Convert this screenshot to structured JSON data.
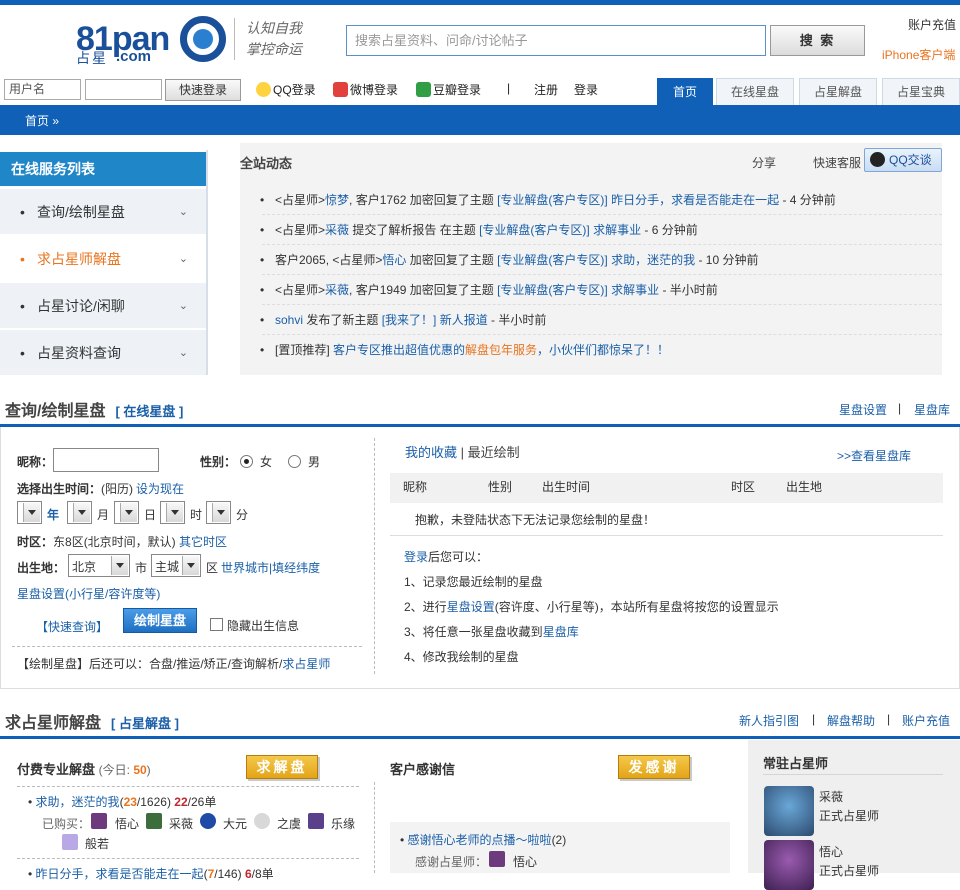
{
  "header": {
    "logo_num": "81pan",
    "logo_zx": "占星",
    "logo_com": ".com",
    "slogan_1": "认知自我",
    "slogan_2": "掌控命运",
    "search_placeholder": "搜索占星资料、问命/讨论帖子",
    "search_label": "搜 索",
    "recharge": "账户充值",
    "iphone": "iPhone客户端"
  },
  "login": {
    "username_placeholder": "用户名",
    "password_placeholder": "",
    "quick_login": "快速登录",
    "qq": "QQ登录",
    "weibo": "微博登录",
    "douban": "豆瓣登录",
    "sep": "|",
    "register": "注册",
    "login": "登录"
  },
  "nav": {
    "tabs": [
      "首页",
      "在线星盘",
      "占星解盘",
      "占星宝典"
    ]
  },
  "breadcrumb": "首页 »",
  "services": {
    "title": "在线服务列表",
    "items": [
      "查询/绘制星盘",
      "求占星师解盘",
      "占星讨论/闲聊",
      "占星资料查询"
    ],
    "chevron": "⌄"
  },
  "activity": {
    "title": "全站动态",
    "share": "分享",
    "kefu": "快速客服",
    "qq": "QQ交谈",
    "items": [
      {
        "a": "<占星师>",
        "b": "惊梦",
        ", 客户1762 加密回复了主题 ": "",
        "c": "[专业解盘(客户专区)]",
        "d": "昨日分手，求看是否能走在一起",
        "e": " - 4 分钟前"
      },
      {
        "a": "<占星师>",
        "b": "采薇",
        "c": "[专业解盘(客户专区)]",
        "d": "求解事业",
        "e": " - 6 分钟前"
      },
      {
        "a": "客户2065, <占星师>",
        "b": "悟心",
        "c": "[专业解盘(客户专区)]",
        "d": "求助，迷茫的我",
        "e": " - 10 分钟前"
      },
      {
        "a": "<占星师>",
        "b": "采薇",
        "c": "[专业解盘(客户专区)]",
        "d": "求解事业",
        "e": " - 半小时前"
      },
      {
        "b": "sohvi",
        "c": "[我来了！]",
        "d": "新人报道",
        "e": " - 半小时前"
      },
      {
        "a": "[置顶推荐]",
        "d": "客户专区推出超值优惠的",
        "f": "解盘包年服务",
        "g": "，小伙伴们都惊呆了！！"
      }
    ],
    "t1": ", 客户1762 加密回复了主题 ",
    "t2": " 提交了解析报告 在主题 ",
    "t3": " 加密回复了主题 ",
    "t4": ", 客户1949 加密回复了主题 ",
    "t5": " 发布了新主题 "
  },
  "query": {
    "title": "查询/绘制星盘",
    "link": "[ 在线星盘 ]",
    "r1": "星盘设置",
    "sep": "|",
    "r2": "星盘库",
    "nick": "昵称：",
    "gender": "性别：",
    "female": "女",
    "male": "男",
    "birth_label": "选择出生时间：",
    "lunar": "(阳历)",
    "now": "设为现在",
    "units": [
      "年",
      "月",
      "日",
      "时",
      "分"
    ],
    "tz_label": "时区：",
    "tz_val": "东8区(北京时间，默认)",
    "tz_other": "其它时区",
    "place_label": "出生地：",
    "city1": "北京",
    "shi": "市",
    "city2": "主城",
    "qu": "区",
    "world": "世界城市|填经纬度",
    "settings": "星盘设置(小行星/容许度等)",
    "quick": "【快速查询】",
    "draw": "绘制星盘",
    "hide": "隐藏出生信息",
    "after": "【绘制星盘】后还可以：合盘/推运/矫正/查询解析/",
    "after_link": "求占星师",
    "fav": "我的收藏",
    "fav_sep": "|",
    "recent": "最近绘制",
    "view_lib": ">>查看星盘库",
    "cols": [
      "昵称",
      "性别",
      "出生时间",
      "时区",
      "出生地"
    ],
    "empty": "抱歉，未登陆状态下无法记录您绘制的星盘！",
    "tip_link": "登录",
    "tip_head": "后您可以：",
    "tips": [
      "1、记录您最近绘制的星盘",
      "2、进行",
      "3、将任意一张星盘收藏到",
      "4、修改我绘制的星盘"
    ],
    "tip2_link": "星盘设置",
    "tip2_rest": "(容许度、小行星等)，本站所有星盘将按您的设置显示",
    "tip3_link": "星盘库"
  },
  "solve": {
    "title": "求占星师解盘",
    "link": "[ 占星解盘 ]",
    "r1": "新人指引图",
    "r2": "解盘帮助",
    "r3": "账户充值",
    "paid_title": "付费专业解盘",
    "today_pre": "(今日: ",
    "today": "50",
    "today_post": ")",
    "solve_btn": "求解盘",
    "t1": "求助，迷茫的我",
    "t1_a": "(",
    "t1_b": "23",
    "t1_c": "/1626) ",
    "t1_d": "22",
    "t1_e": "/26单",
    "bought": "已购买：",
    "buyers": [
      "悟心",
      "采薇",
      "大元",
      "之虞",
      "乐缘",
      "般若"
    ],
    "t2": "昨日分手，求看是否能走在一起",
    "t2_a": "(",
    "t2_b": "7",
    "t2_c": "/146) ",
    "t2_d": "6",
    "t2_e": "/8单",
    "thanks_title": "客户感谢信",
    "thanks_btn": "发感谢",
    "letter": "感谢悟心老师的点播～啦啦",
    "letter_n": "(2)",
    "thanks_to": "感谢占星师：",
    "thanks_name": "悟心",
    "resident_title": "常驻占星师",
    "astrologers": [
      {
        "name": "采薇",
        "role": "正式占星师"
      },
      {
        "name": "悟心",
        "role": "正式占星师"
      }
    ]
  }
}
